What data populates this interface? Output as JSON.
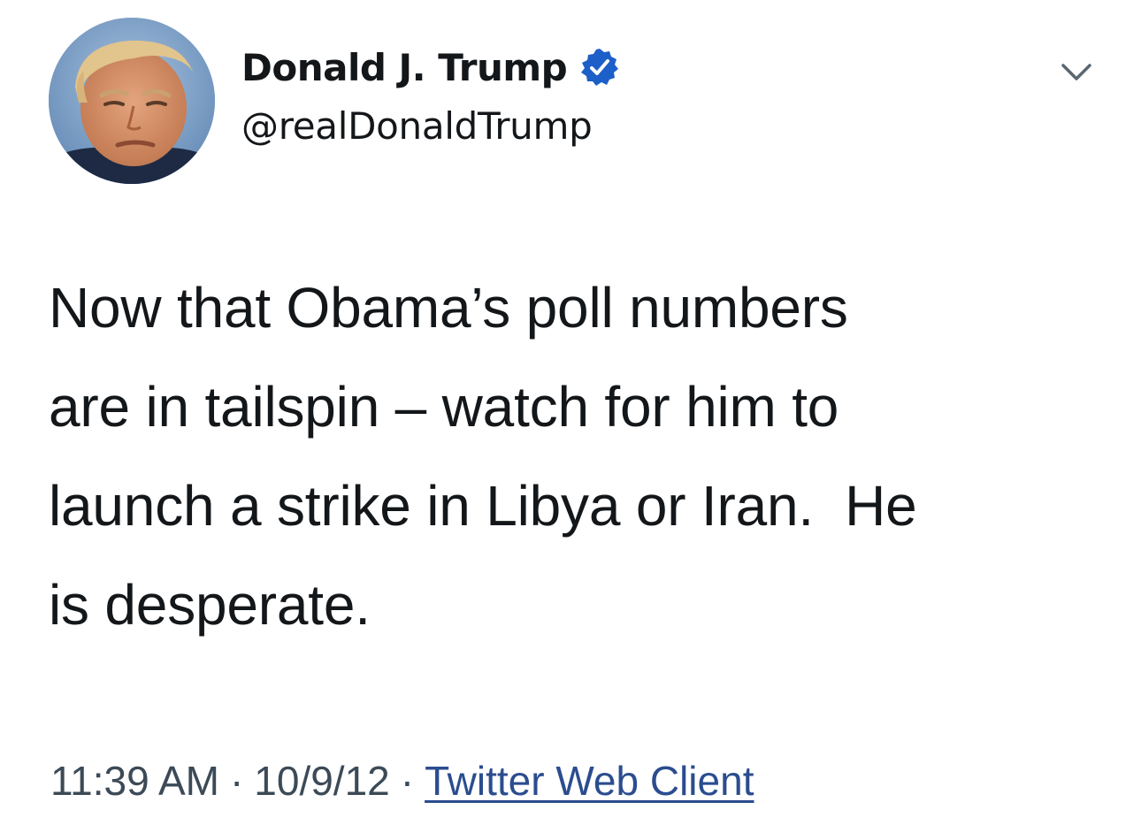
{
  "author": {
    "display_name": "Donald J. Trump",
    "handle": "@realDonaldTrump",
    "verified": true
  },
  "tweet": {
    "lines": [
      "Now that Obama’s poll numbers",
      "are in tailspin – watch for him to",
      "launch a strike in Libya or Iran.  He",
      "is desperate."
    ]
  },
  "meta": {
    "time": "11:39 AM",
    "separator": "·",
    "date": "10/9/12",
    "source": "Twitter Web Client"
  },
  "icons": {
    "verified": "verified-badge-icon",
    "menu": "chevron-down-icon"
  },
  "colors": {
    "verified_badge": "#1d5fc8",
    "source_link": "#2b4d8f",
    "text": "#14171a",
    "meta_text": "#3c4a57"
  }
}
